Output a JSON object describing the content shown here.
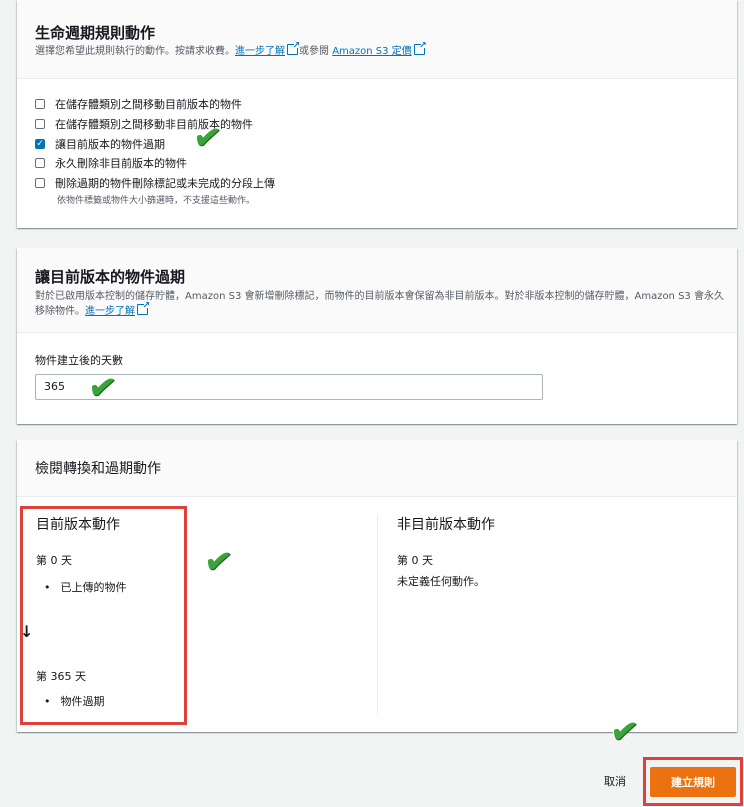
{
  "lifecycle": {
    "title": "生命週期規則動作",
    "desc_prefix": "選擇您希望此規則執行的動作。按請求收費。",
    "learn_more": "進一步了解",
    "desc_mid": "或參閱",
    "pricing_link": "Amazon S3 定價",
    "options": [
      {
        "label": "在儲存體類別之間移動目前版本的物件",
        "checked": false
      },
      {
        "label": "在儲存體類別之間移動非目前版本的物件",
        "checked": false
      },
      {
        "label": "讓目前版本的物件過期",
        "checked": true
      },
      {
        "label": "永久刪除非目前版本的物件",
        "checked": false
      },
      {
        "label": "刪除過期的物件刪除標記或未完成的分段上傳",
        "checked": false
      }
    ],
    "hint": "依物件標籤或物件大小篩選時，不支援這些動作。"
  },
  "expire": {
    "title": "讓目前版本的物件過期",
    "desc": "對於已啟用版本控制的儲存貯體，Amazon S3 會新增刪除標記，而物件的目前版本會保留為非目前版本。對於非版本控制的儲存貯體，Amazon S3 會永久移除物件。",
    "learn_more": "進一步了解",
    "field_label": "物件建立後的天數",
    "field_value": "365"
  },
  "review": {
    "title": "檢閱轉換和過期動作",
    "current": {
      "title": "目前版本動作",
      "day0": "第 0 天",
      "day0_item": "已上傳的物件",
      "arrow": "↓",
      "day365": "第 365 天",
      "day365_item": "物件過期"
    },
    "noncurrent": {
      "title": "非目前版本動作",
      "day0": "第 0 天",
      "day0_text": "未定義任何動作。"
    }
  },
  "footer": {
    "cancel": "取消",
    "create": "建立規則"
  },
  "colors": {
    "accent": "#0073bb",
    "primary_button": "#ec7211",
    "annotation_red": "#e0403a",
    "annotation_check": "#3aa33a"
  },
  "icons": [
    "external-link-icon",
    "checkmark-icon",
    "down-arrow-icon",
    "annotation-check-icon"
  ]
}
